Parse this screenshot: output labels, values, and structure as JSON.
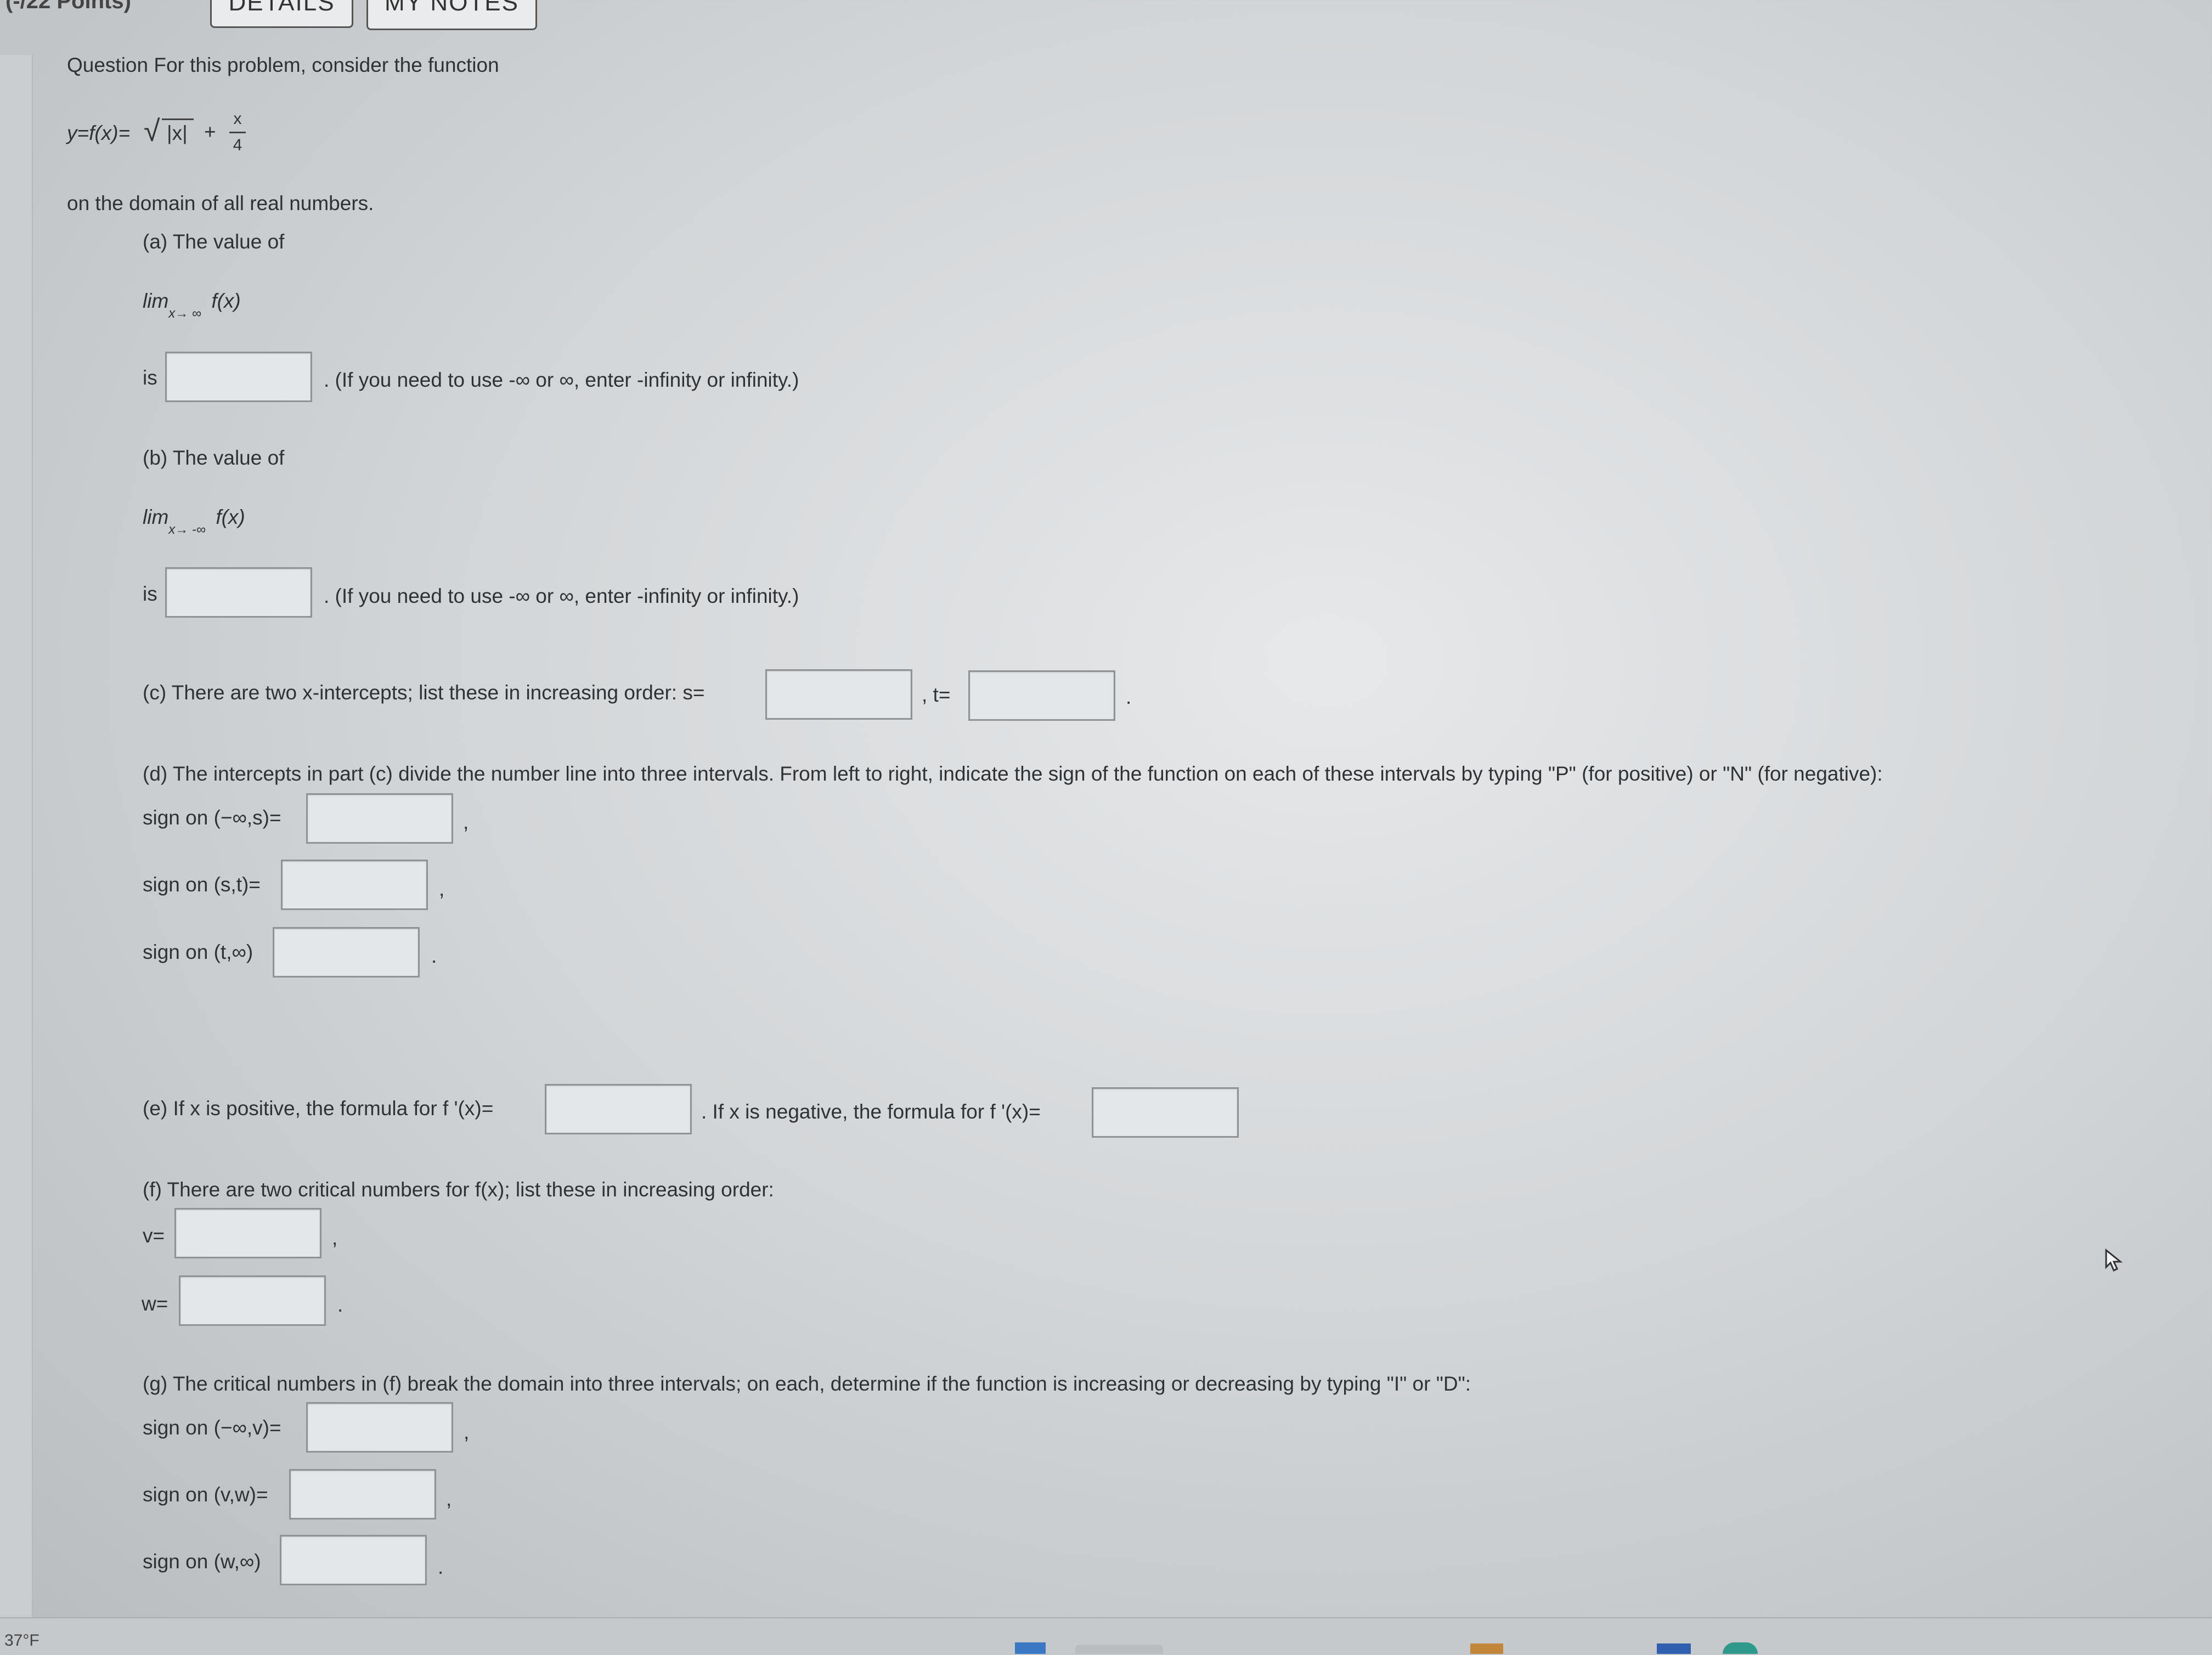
{
  "top": {
    "points": "(-/22 Points)",
    "details_button": "DETAILS",
    "notes_button": "MY NOTES"
  },
  "question": {
    "intro": "Question For this problem, consider the function",
    "func_prefix": "y=f(x)=",
    "func_abs": "|x|",
    "func_plus": "+",
    "frac_num": "x",
    "frac_den": "4",
    "domain": "on the domain of all real numbers."
  },
  "parts": {
    "a": {
      "label": "(a) The value of",
      "lim": "lim",
      "lim_sub": "x→ ∞",
      "lim_fx": "f(x)",
      "is": "is",
      "hint": ". (If you need to use -∞ or ∞, enter -infinity or infinity.)"
    },
    "b": {
      "label": "(b) The value of",
      "lim": "lim",
      "lim_sub": "x→ -∞",
      "lim_fx": "f(x)",
      "is": "is",
      "hint": ". (If you need to use -∞ or ∞, enter -infinity or infinity.)"
    },
    "c": {
      "label": "(c) There are two x-intercepts; list these in increasing order: s=",
      "t_label": ", t=",
      "end": "."
    },
    "d": {
      "label": "(d) The intercepts in part (c) divide the number line into three intervals. From left to right, indicate the sign of the function on each of these intervals by typing \"P\" (for positive) or \"N\" (for negative):",
      "row1": "sign on (−∞,s)=",
      "row2": "sign on (s,t)=",
      "row3": "sign on (t,∞)",
      "comma": ",",
      "period": "."
    },
    "e": {
      "label": "(e) If x is positive, the formula for f '(x)=",
      "label2": ". If x is negative, the formula for f '(x)="
    },
    "f": {
      "label": "(f) There are two critical numbers for f(x); list these in increasing order:",
      "v": "v=",
      "w": "w=",
      "comma": ",",
      "period": "."
    },
    "g": {
      "label": "(g) The critical numbers in (f) break the domain into three intervals; on each, determine if the function is increasing or decreasing by typing \"I\" or \"D\":",
      "row1": "sign on (−∞,v)=",
      "row2": "sign on (v,w)=",
      "row3": "sign on (w,∞)",
      "comma": ",",
      "period": "."
    }
  },
  "taskbar": {
    "temperature": "37°F"
  }
}
